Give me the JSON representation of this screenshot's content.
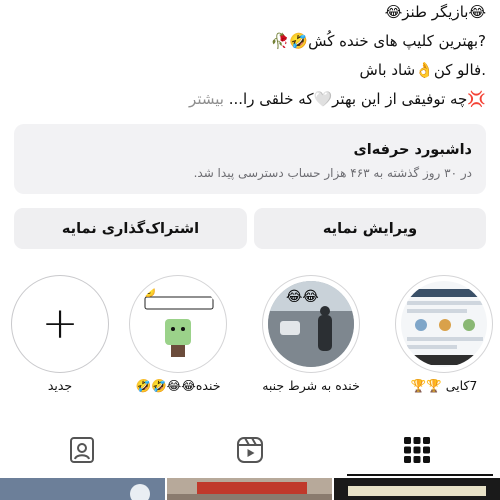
{
  "bio": {
    "lines": [
      "😂بازیگر طنز😂",
      "?بهترین کلیپ های خنده کُش🤣🥀",
      ".فالو کن👌شاد باش",
      "💢چه توفیقی از این بهتر🤍که خلقی را..."
    ],
    "more_label": "بیشتر"
  },
  "dashboard": {
    "title": "داشبورد حرفه‌ای",
    "subtitle": "در ۳۰ روز گذشته به ۴۶۳ هزار حساب دسترسی پیدا شد."
  },
  "buttons": {
    "edit_profile": "ویرایش نمایه",
    "share_profile": "اشتراک‌گذاری نمایه"
  },
  "highlights": [
    {
      "label": "7کایی 🏆🏆",
      "type": "screenshot"
    },
    {
      "label": "خنده به شرط جنبه",
      "type": "street"
    },
    {
      "label": "خنده😂😂🤣🤣",
      "type": "cartoon"
    },
    {
      "label": "جدید",
      "type": "new"
    }
  ],
  "tabs": [
    {
      "icon": "grid-icon",
      "active": true
    },
    {
      "icon": "reels-icon",
      "active": false
    },
    {
      "icon": "tagged-icon",
      "active": false
    }
  ],
  "colors": {
    "background": "#ffffff",
    "card": "#f2f2f4",
    "button": "#efeff1",
    "muted_text": "#8e8e8e",
    "text": "#111111"
  }
}
